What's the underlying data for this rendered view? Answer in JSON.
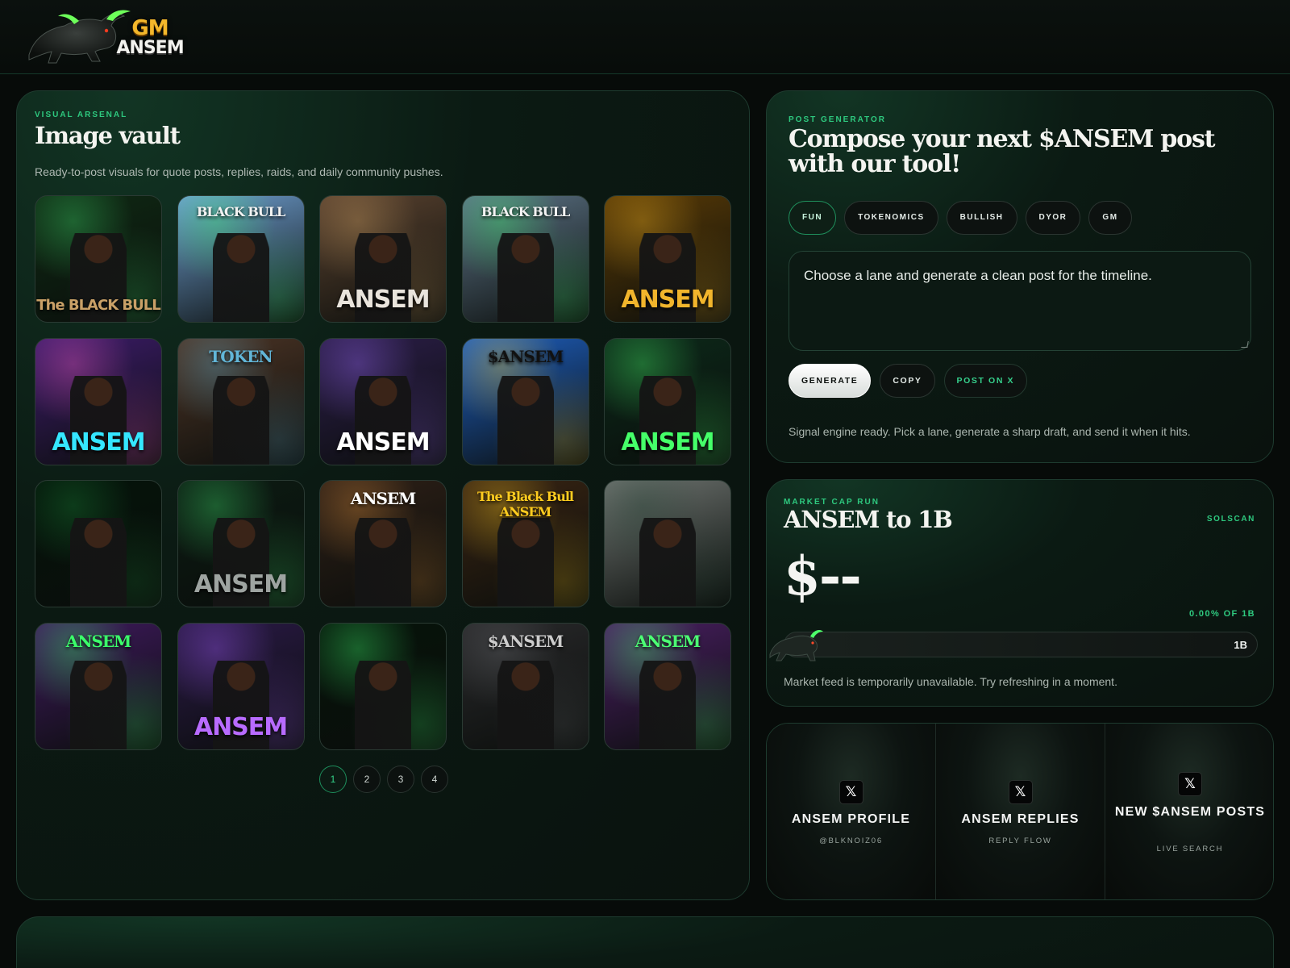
{
  "brand": {
    "logo_line1": "GM",
    "logo_line2": "ANSEM"
  },
  "vault": {
    "eyebrow": "VISUAL ARSENAL",
    "title": "Image vault",
    "description": "Ready-to-post visuals for quote posts, replies, raids, and daily community pushes.",
    "tiles": [
      {
        "label": "The BLACK BULL",
        "bg": "#0f2a14",
        "accent": "#3fe36f",
        "label_color": "#c9a067"
      },
      {
        "label": "BLACK BULL",
        "bg": "#6f9fd1",
        "accent": "#39ff6a",
        "label_color": "#f2f2f2",
        "label_top": true
      },
      {
        "label": "ANSEM",
        "bg": "#5b4330",
        "accent": "#d3a564",
        "label_color": "#e9e4dc"
      },
      {
        "label": "BLACK BULL",
        "bg": "#5d7487",
        "accent": "#3dff6e",
        "label_color": "#f2f2f2",
        "label_top": true
      },
      {
        "label": "ANSEM",
        "bg": "#5a3b06",
        "accent": "#f0b323",
        "label_color": "#f1b52c"
      },
      {
        "label": "ANSEM",
        "bg": "#3d1c6b",
        "accent": "#ff5ec8",
        "label_color": "#35e6ff"
      },
      {
        "label": "TOKEN",
        "bg": "#4d3526",
        "accent": "#62b6d8",
        "label_color": "#62b6d8",
        "label_top": true
      },
      {
        "label": "ANSEM",
        "bg": "#2c1e4a",
        "accent": "#9d6bff",
        "label_color": "#ffffff"
      },
      {
        "label": "$ANSEM",
        "bg": "#1e5fbf",
        "accent": "#ffd22c",
        "label_color": "#111111",
        "label_top": true
      },
      {
        "label": "ANSEM",
        "bg": "#0c2a1a",
        "accent": "#48ff6a",
        "label_color": "#45ff69"
      },
      {
        "label": "",
        "bg": "#04140a",
        "accent": "#1c8c3a",
        "label_color": "#ffffff"
      },
      {
        "label": "ANSEM",
        "bg": "#0c1c13",
        "accent": "#3ee56c",
        "label_color": "#9ea4a1"
      },
      {
        "label": "ANSEM",
        "bg": "#2e2017",
        "accent": "#e6953c",
        "label_color": "#ffffff",
        "label_top": true
      },
      {
        "label": "The Black Bull ANSEM",
        "bg": "#3a2513",
        "accent": "#ffcc1f",
        "label_color": "#ffcc1f",
        "label_top": true
      },
      {
        "label": "",
        "bg": "#6e7470",
        "accent": "#1e4030",
        "label_color": "#ffffff"
      },
      {
        "label": "ANSEM",
        "bg": "#3f1a5e",
        "accent": "#3bff6a",
        "label_color": "#3bff6a",
        "label_top": true
      },
      {
        "label": "ANSEM",
        "bg": "#2b1a48",
        "accent": "#a35cff",
        "label_color": "#b86bff"
      },
      {
        "label": "",
        "bg": "#06140a",
        "accent": "#3dff6e",
        "label_color": "#ffffff"
      },
      {
        "label": "$ANSEM",
        "bg": "#2a2a2c",
        "accent": "#6b6e72",
        "label_color": "#cccccc",
        "label_top": true
      },
      {
        "label": "ANSEM",
        "bg": "#4a1f63",
        "accent": "#4cff74",
        "label_color": "#4cff74",
        "label_top": true
      }
    ],
    "pages": [
      "1",
      "2",
      "3",
      "4"
    ],
    "active_page": "1"
  },
  "generator": {
    "eyebrow": "POST GENERATOR",
    "title": "Compose your next $ANSEM post with our tool!",
    "chips": [
      "FUN",
      "TOKENOMICS",
      "BULLISH",
      "DYOR",
      "GM"
    ],
    "active_chip": "FUN",
    "composer_text": "Choose a lane and generate a clean post for the timeline.",
    "generate_label": "GENERATE",
    "copy_label": "COPY",
    "post_label": "POST ON X",
    "status": "Signal engine ready. Pick a lane, generate a sharp draft, and send it when it hits."
  },
  "market": {
    "eyebrow": "MARKET CAP RUN",
    "title": "ANSEM to 1B",
    "solscan_label": "SOLSCAN",
    "price": "$--",
    "percent_label": "0.00% OF 1B",
    "progress_fraction": 0.0,
    "target_label": "1B",
    "note": "Market feed is temporarily unavailable. Try refreshing in a moment."
  },
  "links": [
    {
      "icon": "x-logo-icon",
      "glyph": "𝕏",
      "title": "ANSEM PROFILE",
      "sub": "@BLKNOIZ06"
    },
    {
      "icon": "x-logo-icon",
      "glyph": "𝕏",
      "title": "ANSEM REPLIES",
      "sub": "REPLY FLOW"
    },
    {
      "icon": "x-logo-icon",
      "glyph": "𝕏",
      "title": "NEW $ANSEM POSTS",
      "sub": "LIVE SEARCH"
    }
  ],
  "colors": {
    "accent": "#2ec97f",
    "background": "#070b09",
    "panel_border": "#1e3b2f"
  }
}
